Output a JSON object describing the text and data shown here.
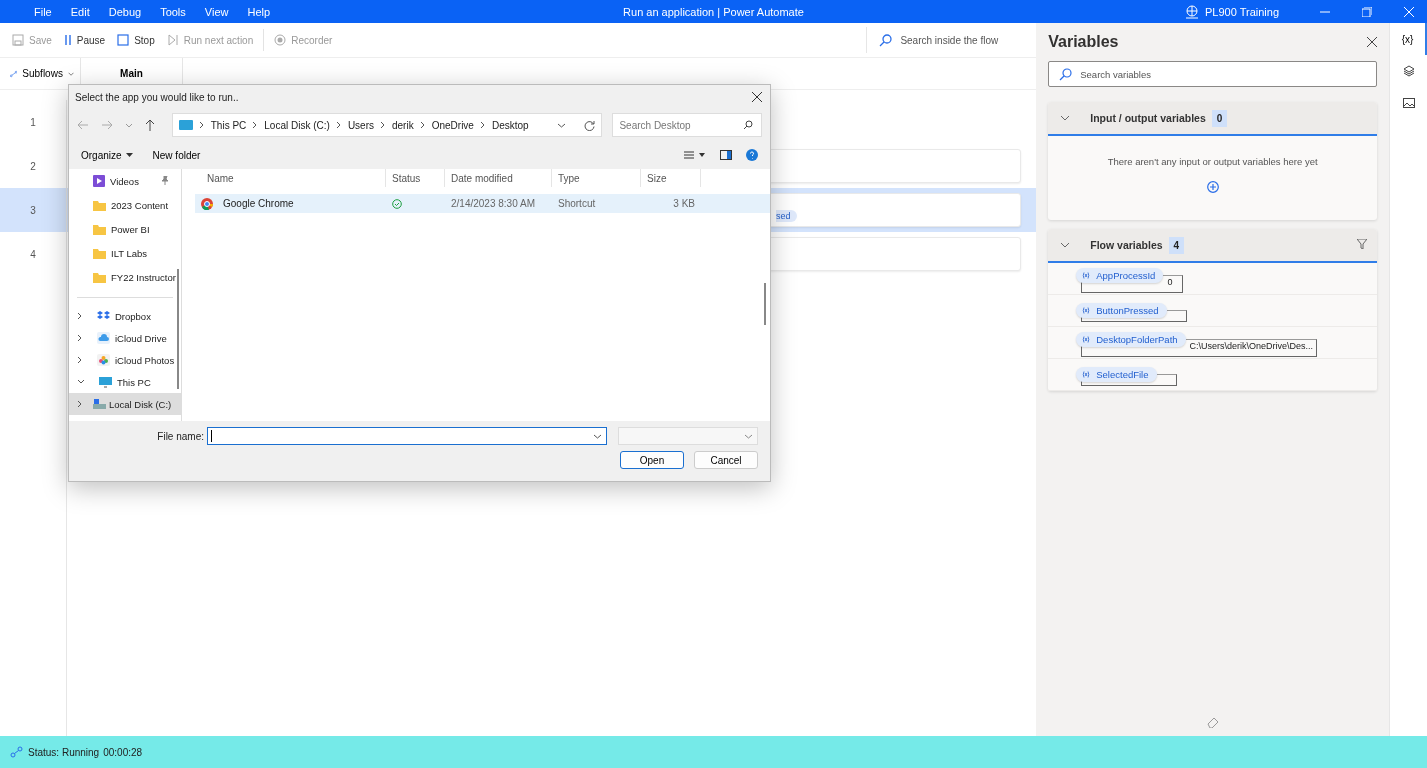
{
  "title_bar": {
    "menu": [
      "File",
      "Edit",
      "Debug",
      "Tools",
      "View",
      "Help"
    ],
    "title": "Run an application | Power Automate",
    "environment": "PL900 Training"
  },
  "toolbar": {
    "buttons": [
      {
        "kind": "save",
        "label": "Save",
        "disabled": true
      },
      {
        "kind": "pause",
        "label": "Pause",
        "disabled": false
      },
      {
        "kind": "stop",
        "label": "Stop",
        "disabled": false
      },
      {
        "kind": "next",
        "label": "Run next action",
        "disabled": true
      },
      {
        "kind": "recorder",
        "label": "Recorder",
        "disabled": true
      }
    ],
    "search": {
      "placeholder": "Search inside the flow"
    }
  },
  "tabs": {
    "subflows": "Subflows",
    "items": [
      {
        "label": "Main",
        "selected": true
      }
    ]
  },
  "flow": {
    "steps": [
      {
        "number": "1",
        "selected": false,
        "card": false
      },
      {
        "number": "2",
        "selected": false,
        "card": true
      },
      {
        "number": "3",
        "selected": true,
        "card": true,
        "chip": "sed"
      },
      {
        "number": "4",
        "selected": false,
        "card": true
      }
    ]
  },
  "dialog": {
    "title": "Select the app you would like to run..",
    "path": [
      "This PC",
      "Local Disk (C:)",
      "Users",
      "derik",
      "OneDrive",
      "Desktop"
    ],
    "search": {
      "placeholder": "Search Desktop"
    },
    "commands": [
      "Organize",
      "New folder"
    ],
    "nav": [
      {
        "kind": "videos",
        "label": "Videos",
        "pinned": true
      },
      {
        "kind": "folder",
        "label": "2023 Content",
        "pinned": false
      },
      {
        "kind": "folder",
        "label": "Power BI",
        "pinned": false
      },
      {
        "kind": "folder",
        "label": "ILT Labs",
        "pinned": false
      },
      {
        "kind": "folder",
        "label": "FY22 Instructor",
        "pinned": false
      }
    ],
    "tree": [
      {
        "kind": "dropbox",
        "label": "Dropbox",
        "expanded": false,
        "selected": false
      },
      {
        "kind": "cloud",
        "label": "iCloud Drive",
        "expanded": false,
        "selected": false
      },
      {
        "kind": "photos",
        "label": "iCloud Photos",
        "expanded": false,
        "selected": false
      },
      {
        "kind": "pc",
        "label": "This PC",
        "expanded": true,
        "selected": false
      },
      {
        "kind": "disk",
        "label": "Local Disk (C:)",
        "expanded": false,
        "selected": true
      }
    ],
    "columns": [
      "Name",
      "Status",
      "Date modified",
      "Type",
      "Size"
    ],
    "files": [
      {
        "name": "Google Chrome",
        "date": "2/14/2023 8:30 AM",
        "type": "Shortcut",
        "size": "3 KB",
        "selected": true
      }
    ],
    "file_name_label": "File name:",
    "buttons": [
      "Open",
      "Cancel"
    ]
  },
  "variables": {
    "title": "Variables",
    "search": {
      "placeholder": "Search variables"
    },
    "sections": [
      {
        "title": "Input / output variables",
        "count": "0",
        "expanded": true,
        "filter": false,
        "empty_text": "There aren't any input or output variables here yet"
      },
      {
        "title": "Flow variables",
        "count": "4",
        "expanded": true,
        "filter": true,
        "items": [
          {
            "name": "AppProcessId",
            "value": "0"
          },
          {
            "name": "ButtonPressed"
          },
          {
            "name": "DesktopFolderPath",
            "value": "C:\\Users\\derik\\OneDrive\\Des..."
          },
          {
            "name": "SelectedFile"
          }
        ]
      }
    ]
  },
  "side_tabs": [
    {
      "kind": "variables",
      "label": "{x}",
      "selected": true
    },
    {
      "kind": "layers",
      "selected": false
    },
    {
      "kind": "images",
      "selected": false
    }
  ],
  "status_bar": {
    "status": "Status: Running",
    "time": "00:00:28"
  }
}
